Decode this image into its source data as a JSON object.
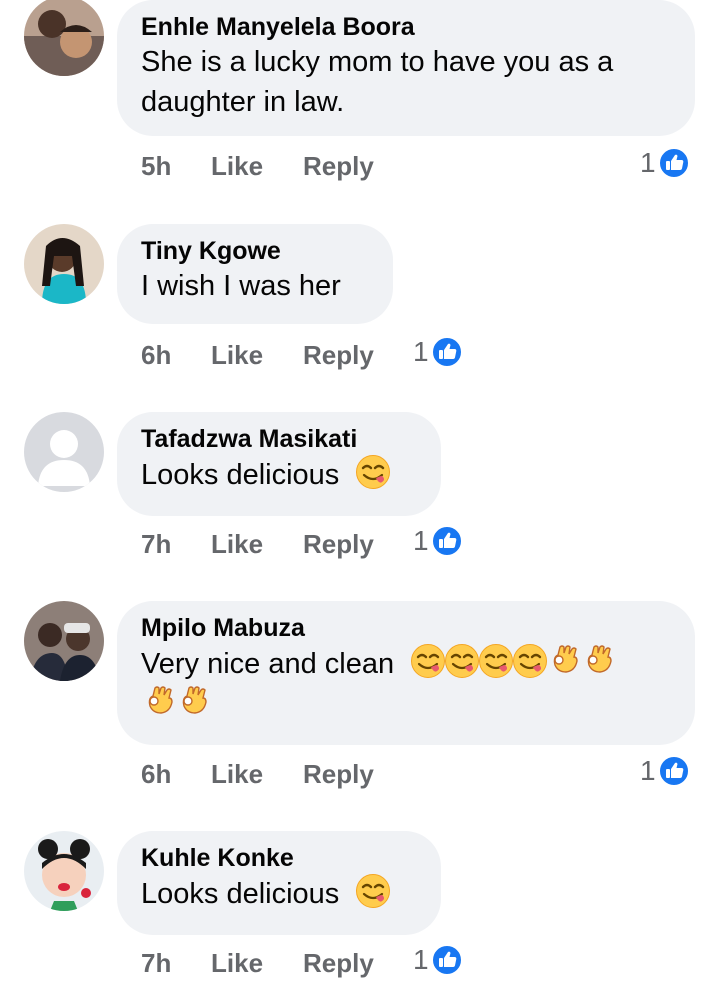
{
  "colors": {
    "bubble": "#f0f2f5",
    "like_blue": "#1877f2",
    "meta_gray": "#65676b"
  },
  "comments": [
    {
      "author": "Enhle Manyelela Boora",
      "text_lines": [
        "She is a lucky mom to have you as a",
        "daughter in law."
      ],
      "time": "5h",
      "like_label": "Like",
      "reply_label": "Reply",
      "reactions": "1",
      "reaction_icon": "like-thumb-icon",
      "avatar": "photo-two-people"
    },
    {
      "author": "Tiny Kgowe",
      "text_lines": [
        "I wish I was her"
      ],
      "time": "6h",
      "like_label": "Like",
      "reply_label": "Reply",
      "reactions": "1",
      "reaction_icon": "like-thumb-icon",
      "avatar": "photo-woman-braids"
    },
    {
      "author": "Tafadzwa Masikati",
      "text_lines": [
        "Looks delicious"
      ],
      "emojis": [
        "yum-face-emoji"
      ],
      "time": "7h",
      "like_label": "Like",
      "reply_label": "Reply",
      "reactions": "1",
      "reaction_icon": "like-thumb-icon",
      "avatar": "default-person-icon"
    },
    {
      "author": "Mpilo Mabuza",
      "text_lines": [
        "Very nice and clean"
      ],
      "emojis": [
        "yum-face-emoji",
        "yum-face-emoji",
        "yum-face-emoji",
        "yum-face-emoji",
        "ok-hand-emoji",
        "ok-hand-emoji",
        "ok-hand-emoji",
        "ok-hand-emoji"
      ],
      "time": "6h",
      "like_label": "Like",
      "reply_label": "Reply",
      "reactions": "1",
      "reaction_icon": "like-thumb-icon",
      "avatar": "photo-two-men"
    },
    {
      "author": "Kuhle Konke",
      "text_lines": [
        "Looks delicious"
      ],
      "emojis": [
        "yum-face-emoji"
      ],
      "time": "7h",
      "like_label": "Like",
      "reply_label": "Reply",
      "reactions": "1",
      "reaction_icon": "like-thumb-icon",
      "avatar": "cartoon-girl-avatar"
    }
  ]
}
